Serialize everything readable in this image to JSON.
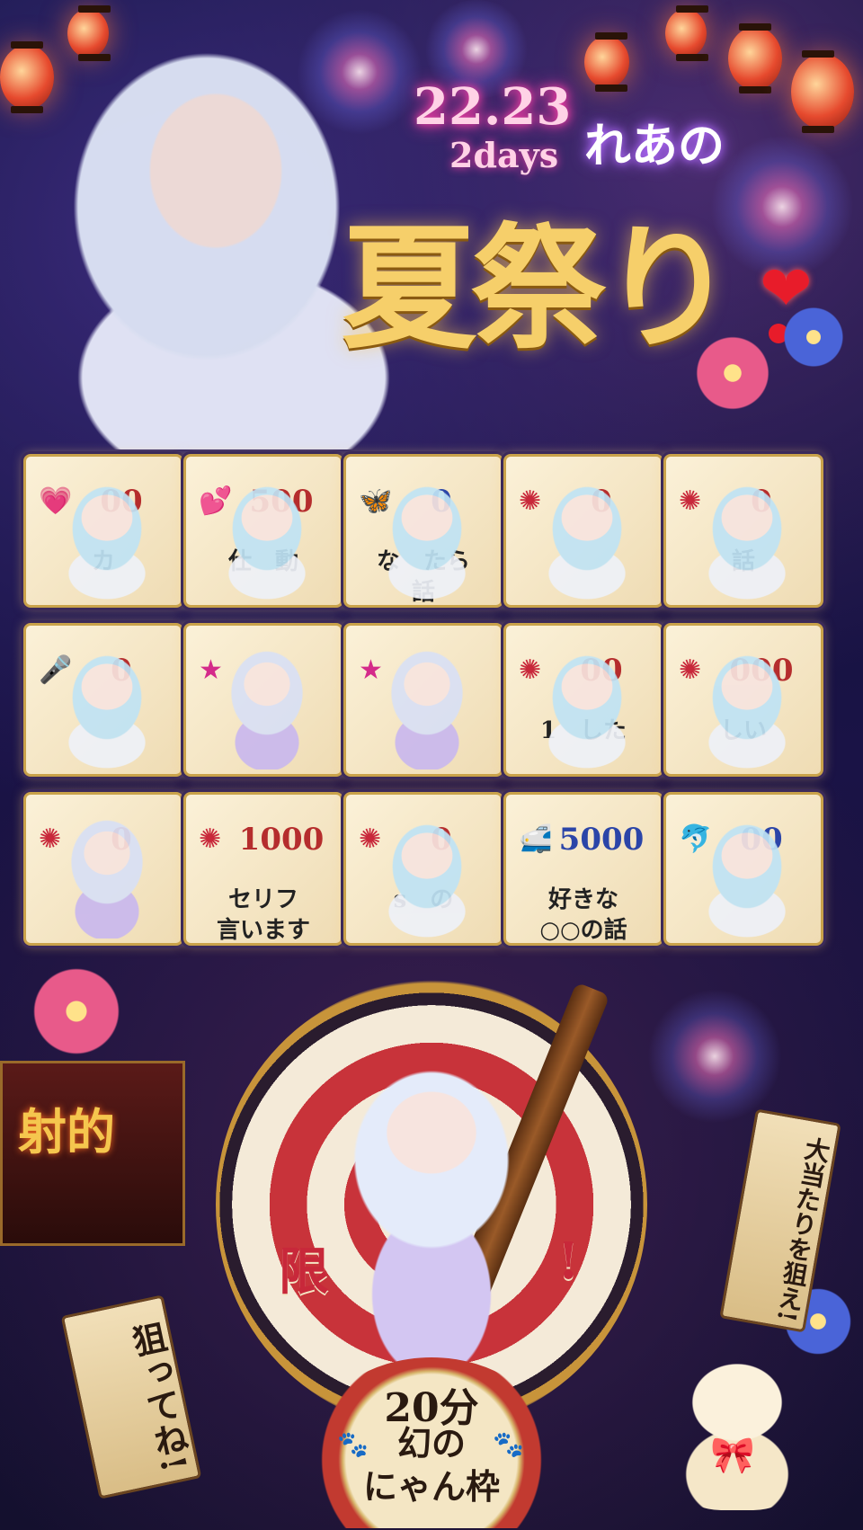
{
  "header": {
    "dates": "22.23",
    "duration": "2days",
    "name": "れあの",
    "title": "夏祭り",
    "heart": "❤"
  },
  "grid": {
    "rows": [
      [
        {
          "value": "00",
          "label": "カ",
          "icon": "heart-icon",
          "theme": "chibi-hoodie"
        },
        {
          "value": "500",
          "label": "仕　動",
          "icon": "hearts-icon",
          "theme": "chibi-hoodie"
        },
        {
          "value": "0",
          "label": "な　たら\n話",
          "icon": "butterfly-icon",
          "theme": "chibi-hoodie"
        },
        {
          "value": "0",
          "label": "",
          "icon": "firework-icon",
          "theme": "chibi-hoodie"
        },
        {
          "value": "0",
          "label": "話",
          "icon": "firework-icon",
          "theme": "chibi-hoodie"
        }
      ],
      [
        {
          "value": "0",
          "label": "",
          "icon": "microphone-icon",
          "theme": "chibi-hoodie"
        },
        {
          "value": "",
          "label": "",
          "icon": "starfish-icon",
          "theme": "chibi-yukata"
        },
        {
          "value": "",
          "label": "",
          "icon": "starfish-icon",
          "theme": "chibi-yukata"
        },
        {
          "value": "00",
          "label": "1　した",
          "icon": "firework-icon",
          "theme": "chibi-hoodie"
        },
        {
          "value": "000",
          "label": "しい",
          "icon": "firework-icon",
          "theme": "chibi-hoodie"
        }
      ],
      [
        {
          "value": "0",
          "label": "",
          "icon": "firework-icon",
          "theme": "chibi-yukata"
        },
        {
          "value": "1000",
          "label": "セリフ\n言います",
          "icon": "firework-icon",
          "theme": "none"
        },
        {
          "value": "0",
          "label": "s　の",
          "icon": "firework-icon",
          "theme": "chibi-hoodie"
        },
        {
          "value": "5000",
          "label": "好きな\n○○の話",
          "icon": "train-icon",
          "theme": "none"
        },
        {
          "value": "00",
          "label": "",
          "icon": "dolphin-icon",
          "theme": "chibi-hoodie"
        }
      ]
    ]
  },
  "booth": {
    "stall_sign": "射的",
    "tag_left": "狙ってね!",
    "tag_right": "大当たりを狙え!",
    "banner_left": "限",
    "banner_right": "!",
    "plaque_time": "20分",
    "plaque_name": "幻の\nにゃん枠",
    "paw": "🐾"
  },
  "colors": {
    "title_gold": "#f6cf6a",
    "neon_pink": "#ff3fa8",
    "card_red": "#b52d2d",
    "card_blue": "#2b45a8"
  }
}
